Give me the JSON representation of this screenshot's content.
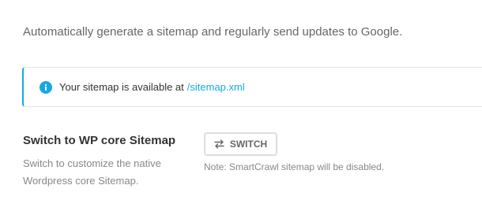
{
  "description": "Automatically generate a sitemap and regularly send updates to Google.",
  "notice": {
    "icon": "info-icon",
    "text": "Your sitemap is available at",
    "link_text": "/sitemap.xml",
    "accent_color": "#17a8e3"
  },
  "setting": {
    "title": "Switch to WP core Sitemap",
    "description": "Switch to customize the native Wordpress core Sitemap.",
    "button_icon": "switch-arrows-icon",
    "button_label": "SWITCH",
    "note": "Note: SmartCrawl sitemap will be disabled."
  }
}
